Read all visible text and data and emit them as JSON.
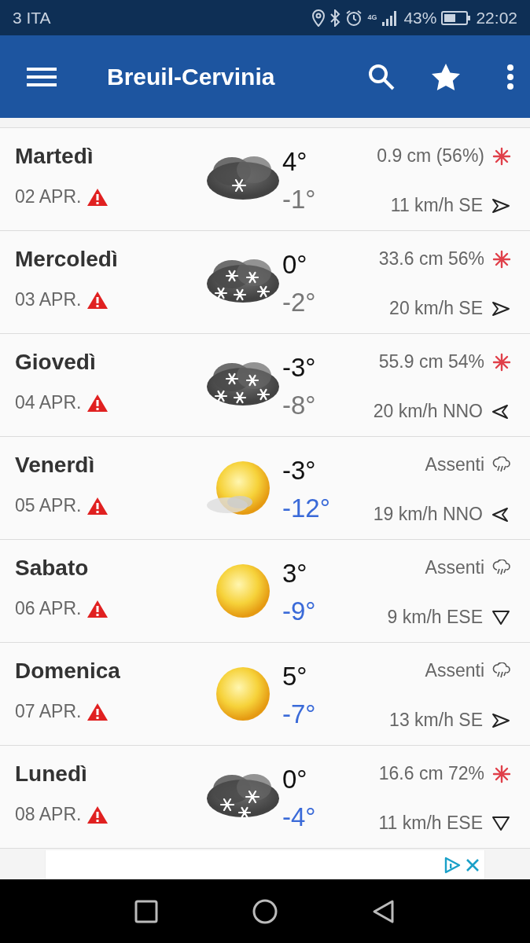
{
  "status_bar": {
    "carrier": "3 ITA",
    "network": "4G",
    "battery": "43%",
    "time": "22:02"
  },
  "app_bar": {
    "title": "Breuil-Cervinia"
  },
  "days": [
    {
      "day": "Martedì",
      "date": "02 APR.",
      "alert": true,
      "weather": {
        "kind": "snow-light"
      },
      "high": "4°",
      "low": "-1°",
      "low_highlight": false,
      "precip": {
        "text": "0.9 cm (56%)",
        "kind": "snow"
      },
      "wind": {
        "text": "11 km/h SE",
        "kind": "right"
      }
    },
    {
      "day": "Mercoledì",
      "date": "03 APR.",
      "alert": true,
      "weather": {
        "kind": "snow-heavy"
      },
      "high": "0°",
      "low": "-2°",
      "low_highlight": false,
      "precip": {
        "text": "33.6 cm 56%",
        "kind": "snow"
      },
      "wind": {
        "text": "20 km/h SE",
        "kind": "right"
      }
    },
    {
      "day": "Giovedì",
      "date": "04 APR.",
      "alert": true,
      "weather": {
        "kind": "snow-heavy"
      },
      "high": "-3°",
      "low": "-8°",
      "low_highlight": false,
      "precip": {
        "text": "55.9 cm 54%",
        "kind": "snow"
      },
      "wind": {
        "text": "20 km/h NNO",
        "kind": "left"
      }
    },
    {
      "day": "Venerdì",
      "date": "05 APR.",
      "alert": true,
      "weather": {
        "kind": "sun-fog"
      },
      "high": "-3°",
      "low": "-12°",
      "low_highlight": true,
      "precip": {
        "text": "Assenti",
        "kind": "none"
      },
      "wind": {
        "text": "19 km/h NNO",
        "kind": "left"
      }
    },
    {
      "day": "Sabato",
      "date": "06 APR.",
      "alert": true,
      "weather": {
        "kind": "sun"
      },
      "high": "3°",
      "low": "-9°",
      "low_highlight": true,
      "precip": {
        "text": "Assenti",
        "kind": "none"
      },
      "wind": {
        "text": "9 km/h ESE",
        "kind": "down"
      }
    },
    {
      "day": "Domenica",
      "date": "07 APR.",
      "alert": true,
      "weather": {
        "kind": "sun"
      },
      "high": "5°",
      "low": "-7°",
      "low_highlight": true,
      "precip": {
        "text": "Assenti",
        "kind": "none"
      },
      "wind": {
        "text": "13 km/h SE",
        "kind": "right"
      }
    },
    {
      "day": "Lunedì",
      "date": "08 APR.",
      "alert": true,
      "weather": {
        "kind": "snow-light3"
      },
      "high": "0°",
      "low": "-4°",
      "low_highlight": true,
      "precip": {
        "text": "16.6 cm 72%",
        "kind": "snow"
      },
      "wind": {
        "text": "11 km/h ESE",
        "kind": "down"
      }
    }
  ]
}
